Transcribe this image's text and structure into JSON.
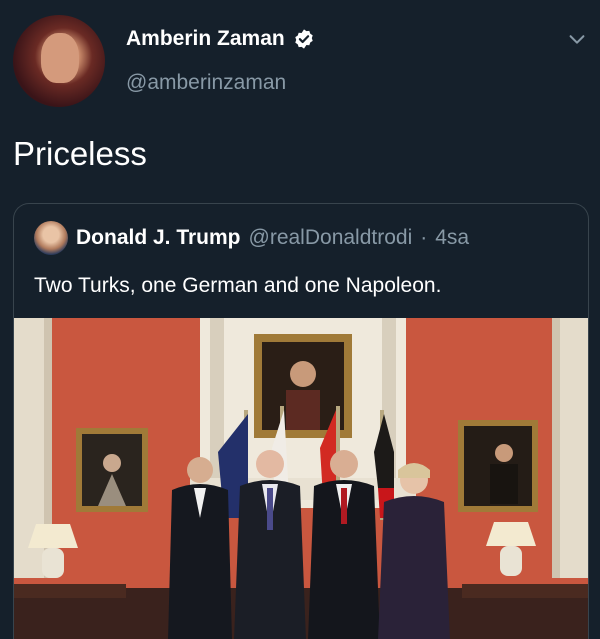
{
  "tweet": {
    "author_name": "Amberin Zaman",
    "author_handle": "@amberinzaman",
    "text": "Priceless",
    "verified": true
  },
  "quoted_tweet": {
    "author_name": "Donald J. Trump",
    "author_handle": "@realDonaldtrodi",
    "separator": "·",
    "time": "4sa",
    "text": "Two Turks, one German and one Napoleon."
  },
  "colors": {
    "background": "#15202b",
    "secondary_text": "#8899a6",
    "verified_badge": "#ffffff",
    "border": "#38444d"
  },
  "icons": [
    "verified-icon",
    "chevron-down-icon"
  ]
}
